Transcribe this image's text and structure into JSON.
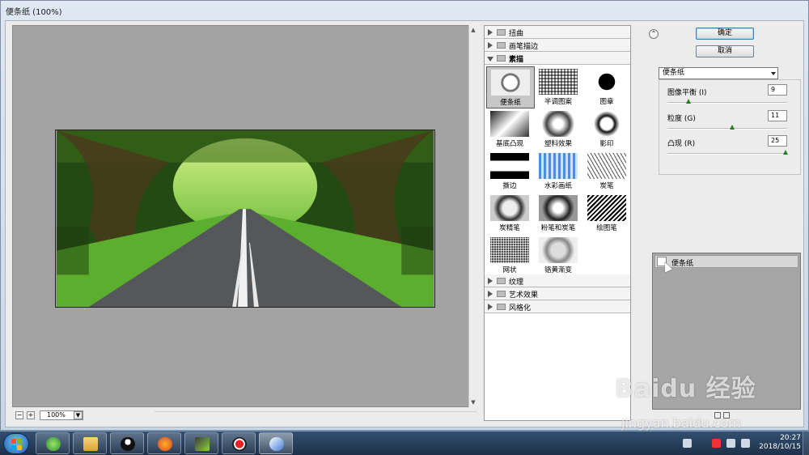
{
  "window": {
    "title": "便条纸 (100%)"
  },
  "preview": {
    "zoom_value": "100%",
    "zoom_out_label": "−",
    "zoom_in_label": "+"
  },
  "filters": {
    "categories_top": [
      {
        "label": "扭曲",
        "expanded": false
      },
      {
        "label": "画笔描边",
        "expanded": false
      },
      {
        "label": "素描",
        "expanded": true
      }
    ],
    "items": [
      {
        "label": "便条纸",
        "selected": true
      },
      {
        "label": "半调图案",
        "selected": false
      },
      {
        "label": "图章",
        "selected": false
      },
      {
        "label": "基底凸现",
        "selected": false
      },
      {
        "label": "塑料效果",
        "selected": false
      },
      {
        "label": "影印",
        "selected": false
      },
      {
        "label": "撕边",
        "selected": false
      },
      {
        "label": "水彩画纸",
        "selected": false
      },
      {
        "label": "炭笔",
        "selected": false
      },
      {
        "label": "炭精笔",
        "selected": false
      },
      {
        "label": "粉笔和炭笔",
        "selected": false
      },
      {
        "label": "绘图笔",
        "selected": false
      },
      {
        "label": "网状",
        "selected": false
      },
      {
        "label": "铬黄渐变",
        "selected": false
      }
    ],
    "categories_bottom": [
      {
        "label": "纹理",
        "expanded": false
      },
      {
        "label": "艺术效果",
        "expanded": false
      },
      {
        "label": "风格化",
        "expanded": false
      }
    ]
  },
  "settings": {
    "ok_label": "确定",
    "cancel_label": "取消",
    "selected_filter": "便条纸",
    "params": [
      {
        "label": "图像平衡 (I)",
        "value": "9",
        "level": 0.18
      },
      {
        "label": "粒度 (G)",
        "value": "11",
        "level": 0.55
      },
      {
        "label": "凸现 (R)",
        "value": "25",
        "level": 1.0
      }
    ],
    "layer_name": "便条纸"
  },
  "taskbar": {
    "time": "20:27",
    "date": "2018/10/15"
  },
  "watermark": {
    "logo": "Baidu 经验",
    "url": "jingyan.baidu.com"
  },
  "colors": {
    "preview_bg": "#a3a3a3",
    "selected_thumb": "#c7c7c7",
    "slider_knob": "#2a7a2a"
  }
}
